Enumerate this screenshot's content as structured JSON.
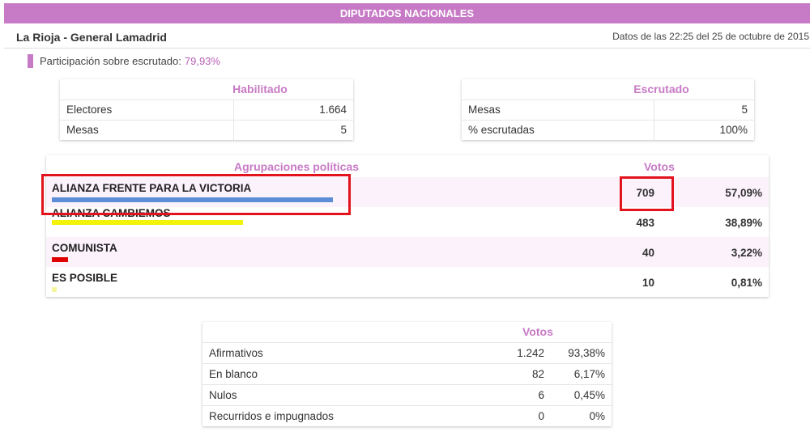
{
  "header": {
    "title": "DIPUTADOS NACIONALES",
    "location": "La Rioja - General Lamadrid",
    "timestamp": "Datos de las 22:25 del 25 de octubre de 2015"
  },
  "participation": {
    "label": "Participación sobre escrutado:",
    "value": "79,93%",
    "color": "#c77ac5"
  },
  "habilitado": {
    "header": "Habilitado",
    "rows": [
      {
        "label": "Electores",
        "value": "1.664"
      },
      {
        "label": "Mesas",
        "value": "5"
      }
    ]
  },
  "escrutado": {
    "header": "Escrutado",
    "rows": [
      {
        "label": "Mesas",
        "value": "5"
      },
      {
        "label": "% escrutadas",
        "value": "100%"
      }
    ]
  },
  "parties": {
    "header_name": "Agrupaciones políticas",
    "header_votes": "Votos",
    "rows": [
      {
        "name": "ALIANZA FRENTE PARA LA VICTORIA",
        "votes": "709",
        "pct": "57,09%",
        "share": 0.5709,
        "color": "#5b8ed6"
      },
      {
        "name": "ALIANZA CAMBIEMOS",
        "votes": "483",
        "pct": "38,89%",
        "share": 0.3889,
        "color": "#f5f20a"
      },
      {
        "name": "COMUNISTA",
        "votes": "40",
        "pct": "3,22%",
        "share": 0.0322,
        "color": "#e00000"
      },
      {
        "name": "ES POSIBLE",
        "votes": "10",
        "pct": "0,81%",
        "share": 0.0081,
        "color": "#f7f59a"
      }
    ]
  },
  "votos": {
    "header": "Votos",
    "rows": [
      {
        "label": "Afirmativos",
        "votes": "1.242",
        "pct": "93,38%"
      },
      {
        "label": "En blanco",
        "votes": "82",
        "pct": "6,17%"
      },
      {
        "label": "Nulos",
        "votes": "6",
        "pct": "0,45%"
      },
      {
        "label": "Recurridos e impugnados",
        "votes": "0",
        "pct": "0%"
      }
    ]
  },
  "highlight_color": "#e2131c"
}
